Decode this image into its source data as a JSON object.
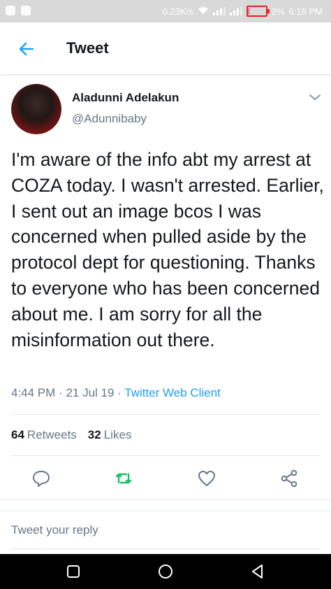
{
  "status_bar": {
    "network_speed": "0.23K/s",
    "battery_percent": "2%",
    "battery_level": 0.02,
    "time": "6:18 PM"
  },
  "app_bar": {
    "title": "Tweet",
    "back_icon": "arrow-left-icon"
  },
  "tweet": {
    "author_name": "Aladunni Adelakun",
    "author_handle": "@Adunnibaby",
    "text": "I'm aware of the info abt my arrest at COZA today. I wasn't arrested. Earlier, I sent out an image bcos I was concerned when pulled aside by the protocol dept for questioning. Thanks to everyone who has been concerned about me. I am sorry for all the misinformation out there.",
    "time": "4:44 PM",
    "date": "21 Jul 19",
    "client": "Twitter Web Client",
    "retweets_count": "64",
    "retweets_label": "Retweets",
    "likes_count": "32",
    "likes_label": "Likes"
  },
  "actions": [
    "reply-icon",
    "retweet-icon",
    "like-icon",
    "share-icon"
  ],
  "reply_box": {
    "placeholder": "Tweet your reply"
  },
  "colors": {
    "accent": "#1da1f2",
    "retweet": "#17bf63",
    "battery": "#e02424"
  }
}
